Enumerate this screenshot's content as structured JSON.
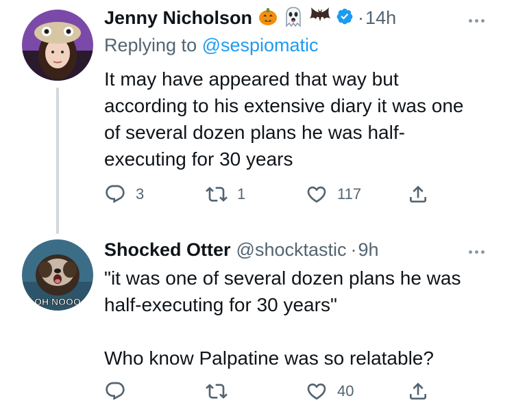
{
  "tweet1": {
    "display_name": "Jenny Nicholson",
    "name_emojis": [
      "pumpkin-emoji",
      "ghost-emoji",
      "bat-emoji"
    ],
    "verified": true,
    "dot": "·",
    "time": "14h",
    "replying_prefix": "Replying to ",
    "replying_to": "@sespiomatic",
    "text": "It may have appeared that way but\naccording to his extensive diary it was one\nof several dozen plans he was half-\nexecuting for 30 years",
    "actions": {
      "reply_count": "3",
      "retweet_count": "1",
      "like_count": "117"
    }
  },
  "tweet2": {
    "display_name": "Shocked Otter",
    "handle": "@shocktastic",
    "dot": "·",
    "time": "9h",
    "avatar_caption": "OH NOOO",
    "text": "\"it was one of several dozen plans he was\nhalf-executing for 30 years\"\n\nWho know Palpatine was so relatable?",
    "actions": {
      "reply_count": "",
      "retweet_count": "",
      "like_count": "40"
    }
  },
  "colors": {
    "text_primary": "#0f1419",
    "text_secondary": "#536471",
    "link": "#1d9bf0",
    "thread_line": "#cfd9de"
  }
}
